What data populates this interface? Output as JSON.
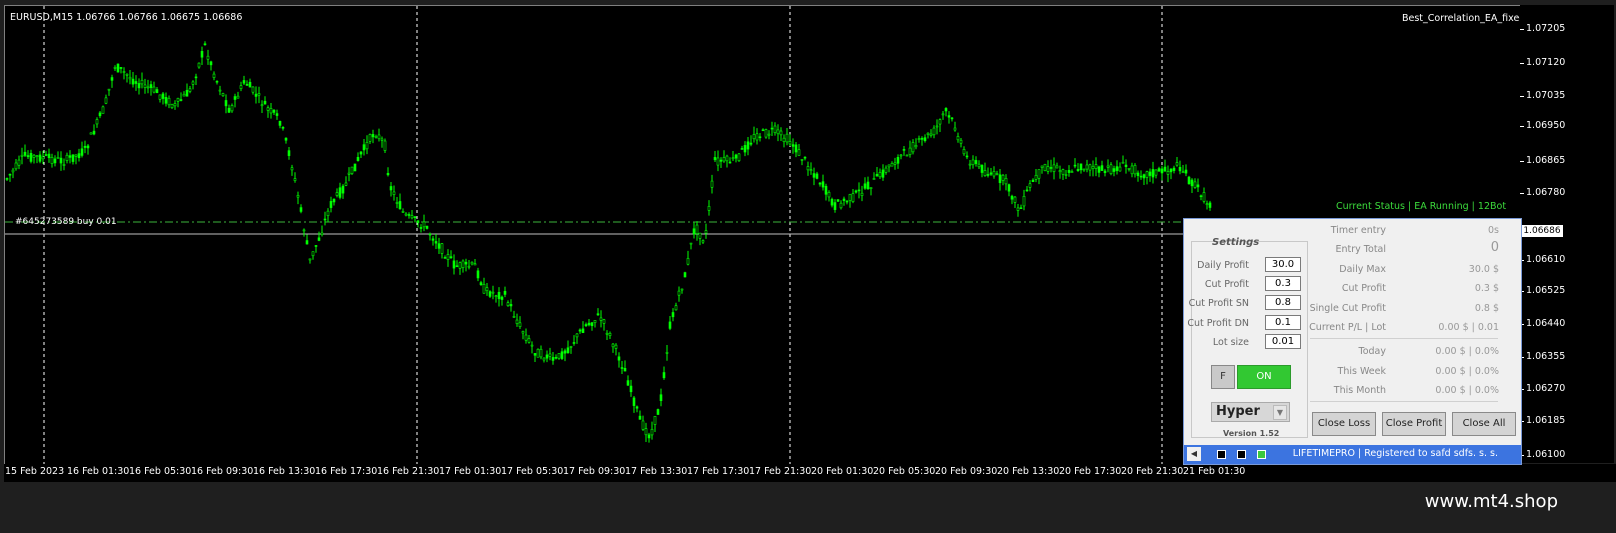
{
  "chart": {
    "symbol_info": "EURUSD,M15  1.06766 1.06766 1.06675 1.06686",
    "ea_name": "Best_Correlation_EA_fixed",
    "order_label": "#645273589 buy 0.01",
    "current_price": "1.06686",
    "status_line": "Current Status | EA Running | 12Bot",
    "price_labels": [
      "1.07205",
      "1.07120",
      "1.07035",
      "1.06950",
      "1.06865",
      "1.06780",
      "1.06610",
      "1.06525",
      "1.06440",
      "1.06355",
      "1.06270",
      "1.06185",
      "1.06100"
    ],
    "time_labels": [
      "15 Feb 2023",
      "16 Feb 01:30",
      "16 Feb 05:30",
      "16 Feb 09:30",
      "16 Feb 13:30",
      "16 Feb 17:30",
      "16 Feb 21:30",
      "17 Feb 01:30",
      "17 Feb 05:30",
      "17 Feb 09:30",
      "17 Feb 13:30",
      "17 Feb 17:30",
      "17 Feb 21:30",
      "20 Feb 01:30",
      "20 Feb 05:30",
      "20 Feb 09:30",
      "20 Feb 13:30",
      "20 Feb 17:30",
      "20 Feb 21:30",
      "21 Feb 01:30"
    ],
    "candle_color": "#00ff00",
    "grid_color": "#ffffff"
  },
  "panel": {
    "settings_title": "Settings",
    "settings": [
      {
        "label": "Daily Profit",
        "value": "30.0"
      },
      {
        "label": "Cut Profit",
        "value": "0.3"
      },
      {
        "label": "Cut Profit SN",
        "value": "0.8"
      },
      {
        "label": "Cut Profit DN",
        "value": "0.1"
      },
      {
        "label": "Lot size",
        "value": "0.01"
      }
    ],
    "f_button": "F",
    "on_button": "ON",
    "mode": "Hyper",
    "version": "Version 1.52",
    "stats": [
      {
        "label": "Timer entry",
        "value": "0s"
      },
      {
        "label": "Entry Total",
        "value": "0"
      },
      {
        "label": "Daily Max",
        "value": "30.0 $"
      },
      {
        "label": "Cut Profit",
        "value": "0.3 $"
      },
      {
        "label": "Single Cut Profit",
        "value": "0.8 $"
      },
      {
        "label": "Current P/L | Lot",
        "value": "0.00 $ | 0.01"
      }
    ],
    "periods": [
      {
        "label": "Today",
        "value": "0.00 $ | 0.0%"
      },
      {
        "label": "This Week",
        "value": "0.00 $ | 0.0%"
      },
      {
        "label": "This Month",
        "value": "0.00 $ | 0.0%"
      }
    ],
    "buttons": {
      "close_loss": "Close Loss",
      "close_profit": "Close Profit",
      "close_all": "Close All"
    },
    "footer_text": "LIFETIMEPRO | Registered to safd sdfs. s. s."
  },
  "brand": "www.mt4.shop"
}
